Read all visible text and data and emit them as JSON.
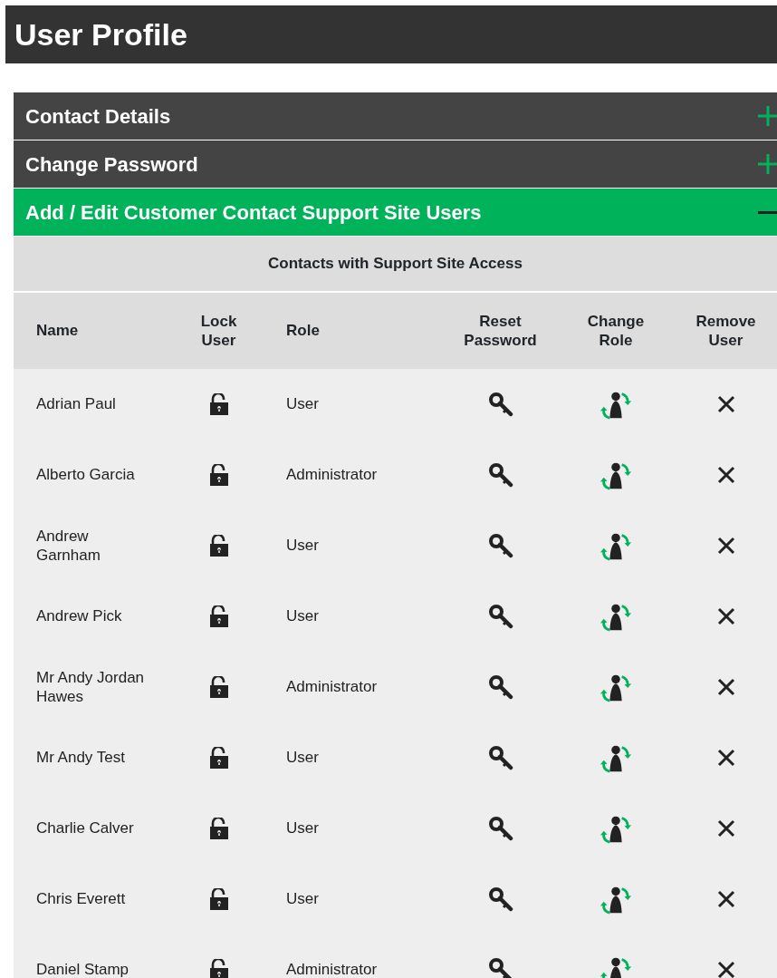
{
  "page_title": "User Profile",
  "sections": [
    {
      "title": "Contact Details",
      "expanded": false
    },
    {
      "title": "Change Password",
      "expanded": false
    },
    {
      "title": "Add / Edit Customer Contact Support Site Users",
      "expanded": true
    }
  ],
  "table": {
    "caption": "Contacts with Support Site Access",
    "columns": [
      "Name",
      "Lock User",
      "Role",
      "Reset Password",
      "Change Role",
      "Remove User"
    ],
    "rows": [
      {
        "name": "Adrian Paul",
        "locked": false,
        "role": "User"
      },
      {
        "name": "Alberto Garcia",
        "locked": false,
        "role": "Administrator"
      },
      {
        "name": "Andrew Garnham",
        "locked": false,
        "role": "User"
      },
      {
        "name": "Andrew Pick",
        "locked": false,
        "role": "User"
      },
      {
        "name": "Mr Andy Jordan Hawes",
        "locked": false,
        "role": "Administrator"
      },
      {
        "name": "Mr Andy Test",
        "locked": false,
        "role": "User"
      },
      {
        "name": "Charlie Calver",
        "locked": false,
        "role": "User"
      },
      {
        "name": "Chris Everett",
        "locked": false,
        "role": "User"
      },
      {
        "name": "Daniel Stamp",
        "locked": false,
        "role": "Administrator"
      }
    ]
  }
}
